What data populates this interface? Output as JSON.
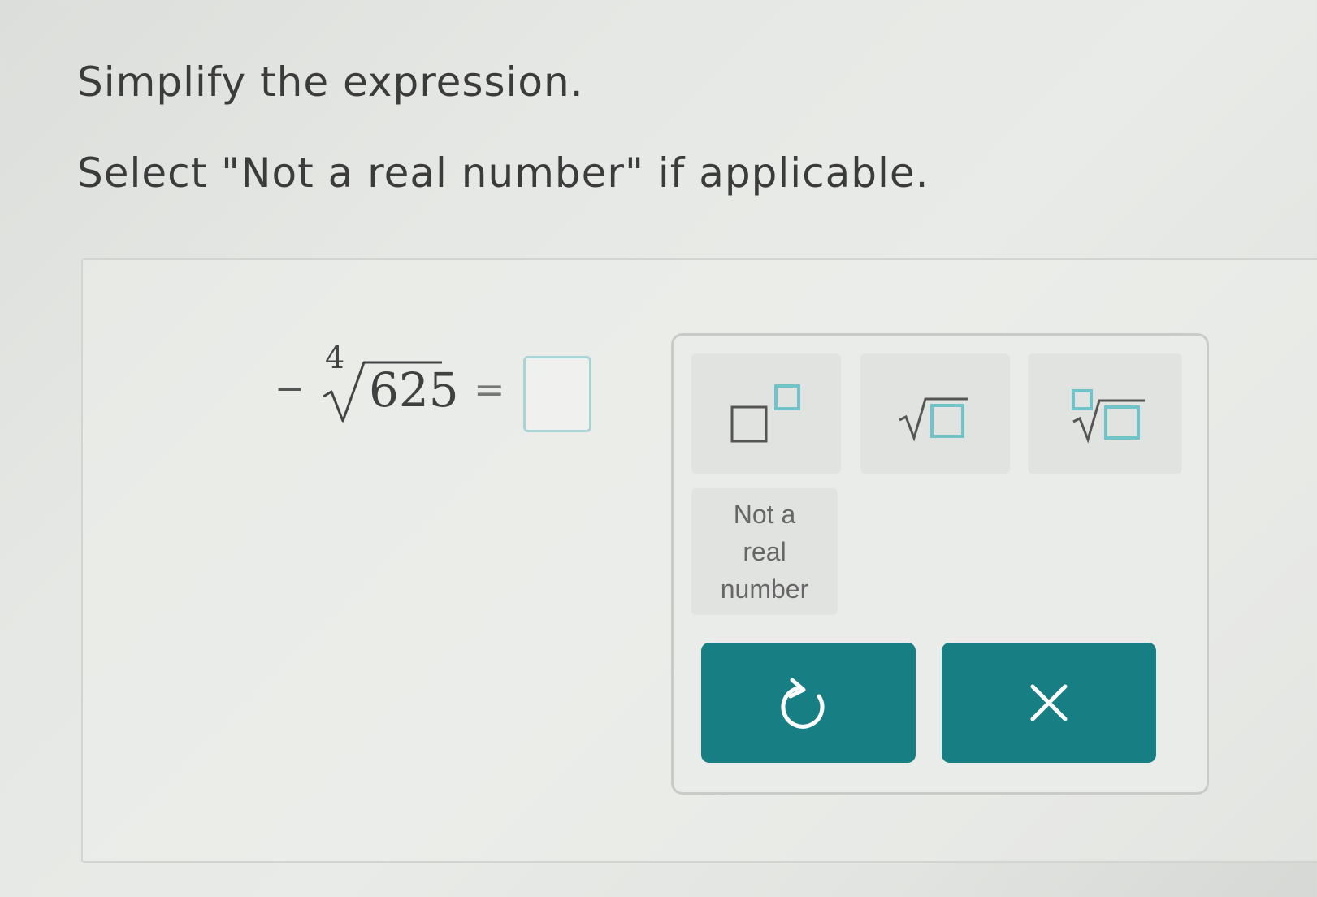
{
  "instructions": {
    "line1": "Simplify the expression.",
    "line2": "Select \"Not a real number\" if applicable."
  },
  "expression": {
    "sign": "−",
    "index": "4",
    "radicand": "625",
    "equals": "=",
    "answer_value": ""
  },
  "keypad": {
    "keys": [
      {
        "name": "exponent",
        "icon": "exponent-template-icon"
      },
      {
        "name": "square-root",
        "icon": "square-root-template-icon"
      },
      {
        "name": "nth-root",
        "icon": "nth-root-template-icon"
      }
    ],
    "not_real_label": "Not a\nreal\nnumber",
    "undo_icon": "undo-icon",
    "clear_icon": "close-icon"
  },
  "colors": {
    "accent": "#177f84",
    "answer_box_border": "#a9d4d6",
    "template_box": "#6fc3c9"
  }
}
